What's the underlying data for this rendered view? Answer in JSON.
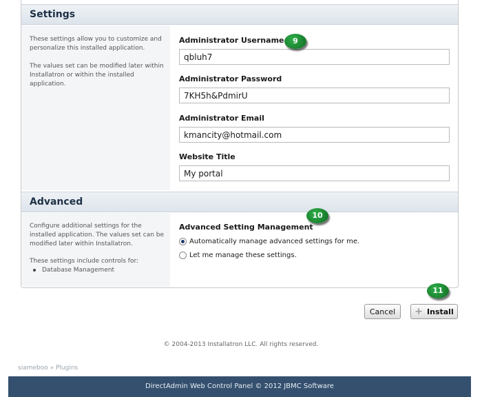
{
  "settings": {
    "title": "Settings",
    "description_1": "These settings allow you to customize and personalize this installed application.",
    "description_2": "The values set can be modified later within Installatron or within the installed application.",
    "fields": [
      {
        "label": "Administrator Username",
        "value": "qbluh7"
      },
      {
        "label": "Administrator Password",
        "value": "7KH5h&PdmirU"
      },
      {
        "label": "Administrator Email",
        "value": "kmancity@hotmail.com"
      },
      {
        "label": "Website Title",
        "value": "My portal"
      }
    ]
  },
  "advanced": {
    "title": "Advanced",
    "description_1": "Configure additional settings for the installed application. The values set can be modified later within Installatron.",
    "description_2": "These settings include controls for:",
    "list": [
      "Database Management"
    ],
    "management_label": "Advanced Setting Management",
    "options": [
      {
        "label": "Automatically manage advanced settings for me.",
        "selected": true
      },
      {
        "label": "Let me manage these settings.",
        "selected": false
      }
    ]
  },
  "actions": {
    "cancel_label": "Cancel",
    "install_label": "Install"
  },
  "callouts": [
    "9",
    "10",
    "11"
  ],
  "copyright": "© 2004-2013 Installatron LLC. All rights reserved.",
  "breadcrumb": {
    "user": "siameboo",
    "separator": "»",
    "page": "Plugins"
  },
  "footer": "DirectAdmin Web Control Panel © 2012 JBMC Software"
}
